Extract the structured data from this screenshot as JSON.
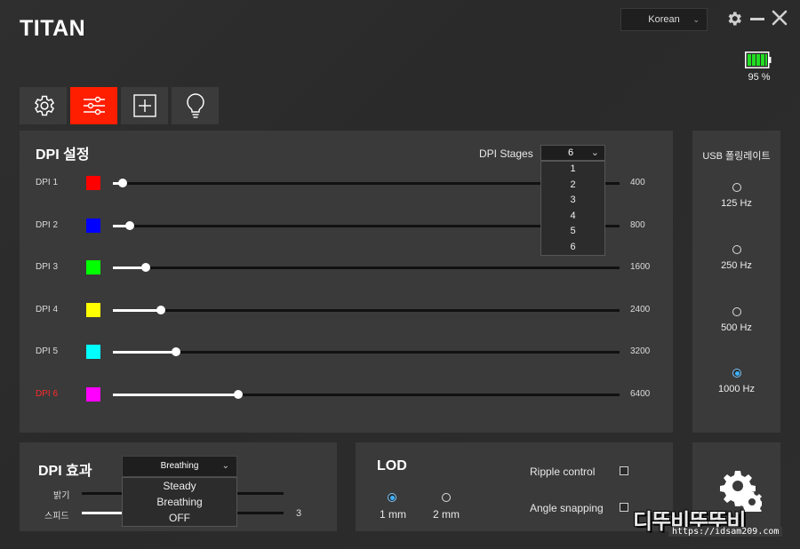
{
  "app": {
    "logo": "TITAN"
  },
  "header": {
    "language": {
      "selected": "Korean"
    },
    "battery": {
      "percent_text": "95 %",
      "level": 0.95
    }
  },
  "tabs": [
    {
      "icon": "settings-gear-icon",
      "active": false
    },
    {
      "icon": "sliders-icon",
      "active": true
    },
    {
      "icon": "add-macro-icon",
      "active": false
    },
    {
      "icon": "lightbulb-icon",
      "active": false
    }
  ],
  "dpi": {
    "title": "DPI 설정",
    "stages_label": "DPI Stages",
    "stages_selected": "6",
    "stages_options": [
      "1",
      "2",
      "3",
      "4",
      "5",
      "6"
    ],
    "rows": [
      {
        "label": "DPI 1",
        "color": "#ff0000",
        "value": "400",
        "level": 0.02,
        "active": false
      },
      {
        "label": "DPI 2",
        "color": "#0000ff",
        "value": "800",
        "level": 0.033,
        "active": false
      },
      {
        "label": "DPI 3",
        "color": "#00ff00",
        "value": "1600",
        "level": 0.065,
        "active": false
      },
      {
        "label": "DPI 4",
        "color": "#ffff00",
        "value": "2400",
        "level": 0.095,
        "active": false
      },
      {
        "label": "DPI 5",
        "color": "#00ffff",
        "value": "3200",
        "level": 0.125,
        "active": false
      },
      {
        "label": "DPI 6",
        "color": "#ff00ff",
        "value": "6400",
        "level": 0.247,
        "active": true
      }
    ]
  },
  "usb": {
    "title": "USB 폴링레이트",
    "options": [
      {
        "label": "125 Hz",
        "selected": false
      },
      {
        "label": "250 Hz",
        "selected": false
      },
      {
        "label": "500 Hz",
        "selected": false
      },
      {
        "label": "1000 Hz",
        "selected": true
      }
    ]
  },
  "effect": {
    "title": "DPI 효과",
    "selected": "Breathing",
    "options": [
      "Steady",
      "Breathing",
      "OFF"
    ],
    "brightness_label": "밝기",
    "speed_label": "스피드",
    "speed_value": "3",
    "brightness_level": 0.0,
    "speed_level": 0.2
  },
  "lod": {
    "title": "LOD",
    "options": [
      {
        "label": "1 mm",
        "selected": true
      },
      {
        "label": "2 mm",
        "selected": false
      }
    ],
    "ripple_label": "Ripple control",
    "angle_label": "Angle snapping",
    "ripple_checked": false,
    "angle_checked": false
  },
  "watermark": {
    "text": "디뚜비뚜뚜비",
    "url": "https://idsam209.com"
  },
  "colors": {
    "accent": "#ff1e00",
    "radio_on": "#3db2ff",
    "battery": "#22dd22"
  }
}
